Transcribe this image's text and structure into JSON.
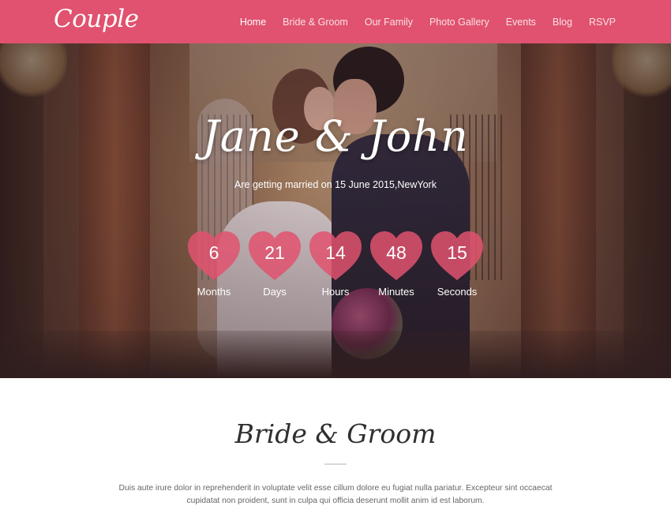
{
  "brand": {
    "logo": "Couple",
    "accent": "#e0526f"
  },
  "nav": [
    {
      "label": "Home",
      "active": true
    },
    {
      "label": "Bride & Groom",
      "active": false
    },
    {
      "label": "Our Family",
      "active": false
    },
    {
      "label": "Photo Gallery",
      "active": false
    },
    {
      "label": "Events",
      "active": false
    },
    {
      "label": "Blog",
      "active": false
    },
    {
      "label": "RSVP",
      "active": false
    }
  ],
  "hero": {
    "names": "Jane & John",
    "subtitle": "Are getting married on 15 June 2015,NewYork",
    "countdown": [
      {
        "value": "6",
        "label": "Months"
      },
      {
        "value": "21",
        "label": "Days"
      },
      {
        "value": "14",
        "label": "Hours"
      },
      {
        "value": "48",
        "label": "Minutes"
      },
      {
        "value": "15",
        "label": "Seconds"
      }
    ],
    "heart_color": "#e0526f"
  },
  "bride_groom": {
    "title": "Bride & Groom",
    "text": "Duis aute irure dolor in reprehenderit in voluptate velit esse cillum dolore eu fugiat nulla pariatur. Excepteur sint occaecat cupidatat non proident, sunt in culpa qui officia deserunt mollit anim id est laborum."
  }
}
